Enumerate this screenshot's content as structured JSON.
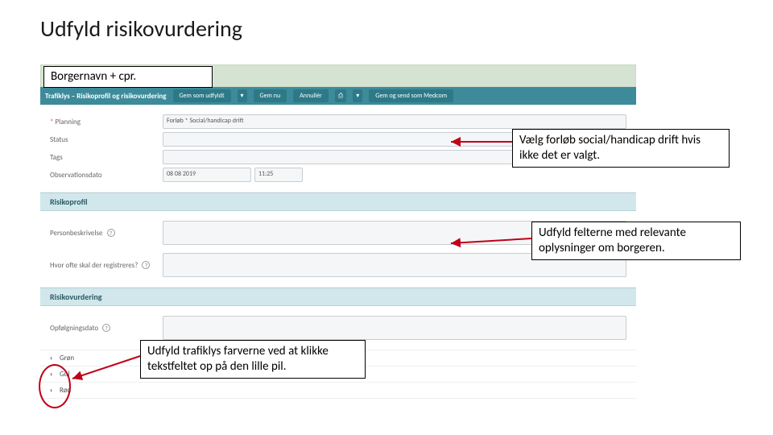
{
  "page": {
    "title": "Udfyld risikovurdering"
  },
  "callouts": {
    "borgernavn": "Borgernavn + cpr.",
    "forlob": "Vælg forløb social/handicap drift hvis ikke det er valgt.",
    "felter": "Udfyld felterne med relevante oplysninger om borgeren.",
    "trafiklys": "Udfyld trafiklys farverne ved at klikke tekstfeltet op på den lille pil."
  },
  "toolbar": {
    "title": "Trafiklys – Risikoprofil og risikovurdering",
    "btn_submit": "Gem som udfyldt",
    "btn_gem": "Gem nu",
    "btn_annuller": "Annullér",
    "btn_print": "⎙",
    "btn_dropdown": "▾",
    "btn_medcom": "Gem og send som Medcom"
  },
  "form": {
    "planning": {
      "label": "Planning",
      "value": "Forløb * Social/handicap drift"
    },
    "status": {
      "label": "Status",
      "value": ""
    },
    "tags": {
      "label": "Tags",
      "value": ""
    },
    "obs": {
      "label": "Observationsdato",
      "date": "08 08 2019",
      "time": "11:25"
    }
  },
  "sections": {
    "risikoprofil": "Risikoprofil",
    "personbeskrivelse": "Personbeskrivelse",
    "hvorofte": "Hvor ofte skal der registreres?",
    "risikovurdering": "Risikovurdering",
    "opfolgning": "Opfølgningsdato"
  },
  "traffic": {
    "gron": "Grøn",
    "gul": "Gul",
    "rod": "Rød"
  }
}
